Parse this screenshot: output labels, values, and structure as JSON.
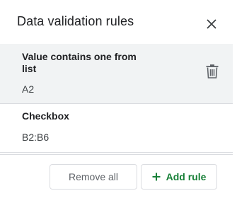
{
  "header": {
    "title": "Data validation rules",
    "close_icon": "close-icon"
  },
  "rules": [
    {
      "title": "Value contains one from list",
      "range": "A2",
      "selected": true,
      "delete_icon": "trash-icon"
    },
    {
      "title": "Checkbox",
      "range": "B2:B6",
      "selected": false
    }
  ],
  "footer": {
    "remove_all_label": "Remove all",
    "add_rule_label": "Add rule",
    "add_icon": "plus-icon"
  },
  "colors": {
    "accent_green": "#188038",
    "selected_bg": "#f1f3f4",
    "divider": "#dadce0",
    "text_primary": "#202124",
    "text_secondary": "#5f6368"
  }
}
